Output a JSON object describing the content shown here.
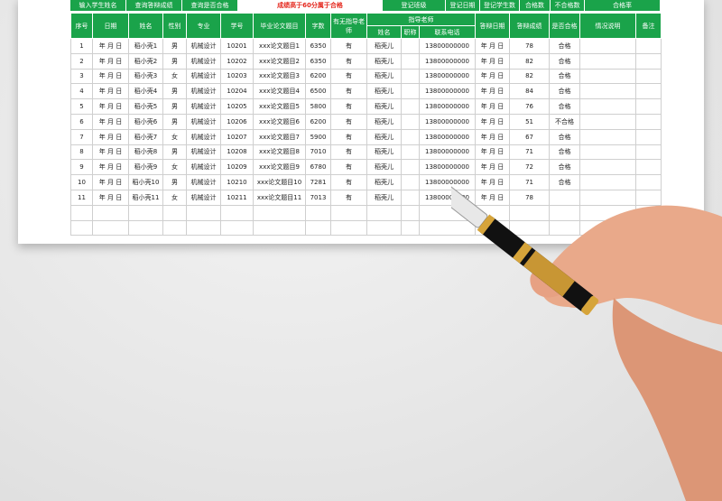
{
  "topbar": [
    {
      "label": "输入学生姓名",
      "w": 62
    },
    {
      "label": "查询答辩成绩",
      "w": 62
    },
    {
      "label": "查询是否合格",
      "w": 62
    },
    {
      "label": "成绩高于60分属于合格",
      "w": 160,
      "mid": true
    },
    {
      "label": "登记班级",
      "w": 70
    },
    {
      "label": "登记日期",
      "w": 38
    },
    {
      "label": "登记学生数",
      "w": 44
    },
    {
      "label": "合格数",
      "w": 34
    },
    {
      "label": "不合格数",
      "w": 38
    },
    {
      "label": "合格率",
      "w": 84
    }
  ],
  "headers": {
    "seq": "序号",
    "date": "日期",
    "name": "姓名",
    "gender": "性别",
    "major": "专业",
    "sid": "学号",
    "thesis": "毕业论文题目",
    "words": "字数",
    "has_advisor": "有无指导老师",
    "advisor_group": "指导老师",
    "advisor_name": "姓名",
    "advisor_title": "职称",
    "advisor_phone": "联系电话",
    "defense_date": "答辩日期",
    "score": "答辩成绩",
    "pass": "是否合格",
    "notes": "情况说明",
    "remark": "备注"
  },
  "rows": [
    {
      "seq": "1",
      "date": "年 月 日",
      "name": "稻小壳1",
      "gender": "男",
      "major": "机械设计",
      "sid": "10201",
      "thesis": "xxx论文题目1",
      "words": "6350",
      "has": "有",
      "adv": "稻壳儿",
      "title": "",
      "phone": "13800000000",
      "ddate": "年 月 日",
      "score": "78",
      "pass": "合格"
    },
    {
      "seq": "2",
      "date": "年 月 日",
      "name": "稻小壳2",
      "gender": "男",
      "major": "机械设计",
      "sid": "10202",
      "thesis": "xxx论文题目2",
      "words": "6350",
      "has": "有",
      "adv": "稻壳儿",
      "title": "",
      "phone": "13800000000",
      "ddate": "年 月 日",
      "score": "82",
      "pass": "合格"
    },
    {
      "seq": "3",
      "date": "年 月 日",
      "name": "稻小壳3",
      "gender": "女",
      "major": "机械设计",
      "sid": "10203",
      "thesis": "xxx论文题目3",
      "words": "6200",
      "has": "有",
      "adv": "稻壳儿",
      "title": "",
      "phone": "13800000000",
      "ddate": "年 月 日",
      "score": "82",
      "pass": "合格"
    },
    {
      "seq": "4",
      "date": "年 月 日",
      "name": "稻小壳4",
      "gender": "男",
      "major": "机械设计",
      "sid": "10204",
      "thesis": "xxx论文题目4",
      "words": "6500",
      "has": "有",
      "adv": "稻壳儿",
      "title": "",
      "phone": "13800000000",
      "ddate": "年 月 日",
      "score": "84",
      "pass": "合格"
    },
    {
      "seq": "5",
      "date": "年 月 日",
      "name": "稻小壳5",
      "gender": "男",
      "major": "机械设计",
      "sid": "10205",
      "thesis": "xxx论文题目5",
      "words": "5800",
      "has": "有",
      "adv": "稻壳儿",
      "title": "",
      "phone": "13800000000",
      "ddate": "年 月 日",
      "score": "76",
      "pass": "合格"
    },
    {
      "seq": "6",
      "date": "年 月 日",
      "name": "稻小壳6",
      "gender": "男",
      "major": "机械设计",
      "sid": "10206",
      "thesis": "xxx论文题目6",
      "words": "6200",
      "has": "有",
      "adv": "稻壳儿",
      "title": "",
      "phone": "13800000000",
      "ddate": "年 月 日",
      "score": "51",
      "pass": "不合格"
    },
    {
      "seq": "7",
      "date": "年 月 日",
      "name": "稻小壳7",
      "gender": "女",
      "major": "机械设计",
      "sid": "10207",
      "thesis": "xxx论文题目7",
      "words": "5900",
      "has": "有",
      "adv": "稻壳儿",
      "title": "",
      "phone": "13800000000",
      "ddate": "年 月 日",
      "score": "67",
      "pass": "合格"
    },
    {
      "seq": "8",
      "date": "年 月 日",
      "name": "稻小壳8",
      "gender": "男",
      "major": "机械设计",
      "sid": "10208",
      "thesis": "xxx论文题目8",
      "words": "7010",
      "has": "有",
      "adv": "稻壳儿",
      "title": "",
      "phone": "13800000000",
      "ddate": "年 月 日",
      "score": "71",
      "pass": "合格"
    },
    {
      "seq": "9",
      "date": "年 月 日",
      "name": "稻小壳9",
      "gender": "女",
      "major": "机械设计",
      "sid": "10209",
      "thesis": "xxx论文题目9",
      "words": "6780",
      "has": "有",
      "adv": "稻壳儿",
      "title": "",
      "phone": "13800000000",
      "ddate": "年 月 日",
      "score": "72",
      "pass": "合格"
    },
    {
      "seq": "10",
      "date": "年 月 日",
      "name": "稻小壳10",
      "gender": "男",
      "major": "机械设计",
      "sid": "10210",
      "thesis": "xxx论文题目10",
      "words": "7281",
      "has": "有",
      "adv": "稻壳儿",
      "title": "",
      "phone": "13800000000",
      "ddate": "年 月 日",
      "score": "71",
      "pass": "合格"
    },
    {
      "seq": "11",
      "date": "年 月 日",
      "name": "稻小壳11",
      "gender": "女",
      "major": "机械设计",
      "sid": "10211",
      "thesis": "xxx论文题目11",
      "words": "7013",
      "has": "有",
      "adv": "稻壳儿",
      "title": "",
      "phone": "13800000000",
      "ddate": "年 月 日",
      "score": "78",
      "pass": ""
    },
    {
      "seq": "",
      "date": "",
      "name": "",
      "gender": "",
      "major": "",
      "sid": "",
      "thesis": "",
      "words": "",
      "has": "",
      "adv": "",
      "title": "",
      "phone": "",
      "ddate": "",
      "score": "",
      "pass": ""
    },
    {
      "seq": "",
      "date": "",
      "name": "",
      "gender": "",
      "major": "",
      "sid": "",
      "thesis": "",
      "words": "",
      "has": "",
      "adv": "",
      "title": "",
      "phone": "",
      "ddate": "",
      "score": "",
      "pass": ""
    }
  ],
  "colors": {
    "green": "#1aa34a",
    "red": "#e4261c"
  },
  "decor": {
    "pen": "fountain-pen-icon",
    "hand": "hand-icon"
  }
}
